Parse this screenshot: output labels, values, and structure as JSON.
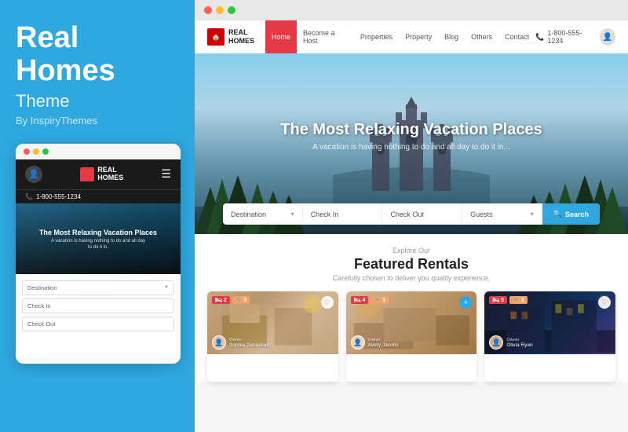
{
  "left": {
    "title_line1": "Real",
    "title_line2": "Homes",
    "subtitle": "Theme",
    "author": "By InspiryThemes",
    "brand_label": "REAL HOMES"
  },
  "mobile": {
    "dots": [
      "red",
      "yellow",
      "green"
    ],
    "nav": {
      "logo_text": "REAL\nHOMES",
      "phone": "1-800-555-1234"
    },
    "hero": {
      "title": "The Most Relaxing Vacation Places",
      "subtitle": "A vacation is having nothing to do and all day\nto do it in."
    },
    "search_fields": [
      "Destination",
      "Check In",
      "Check Out"
    ]
  },
  "desktop": {
    "dots": [
      "red",
      "yellow",
      "green"
    ],
    "nav": {
      "logo_text": "REAL\nHOMES",
      "items": [
        "Home",
        "Become a Host",
        "Properties",
        "Property",
        "Blog",
        "Others",
        "Contact"
      ],
      "active_item": "Home",
      "phone": "1-800-555-1234"
    },
    "hero": {
      "title": "The Most Relaxing Vacation Places",
      "subtitle": "A vacation is having nothing to do and all day to do it in..."
    },
    "search": {
      "fields": [
        "Destination",
        "Check In",
        "Check Out",
        "Guests"
      ],
      "button": "Search"
    },
    "featured": {
      "eyebrow": "Explore Our",
      "title": "Featured Rentals",
      "description": "Carefully chosen to deliver you quality experience.",
      "cards": [
        {
          "owner_label": "Owner",
          "owner_name": "Sophia Sebastian",
          "badges": [
            "2",
            "3"
          ]
        },
        {
          "owner_label": "Owner",
          "owner_name": "Avery Jacobs",
          "badges": [
            "4",
            "3"
          ]
        },
        {
          "owner_label": "Owner",
          "owner_name": "Olivia Ryan",
          "badges": [
            "5",
            "3"
          ]
        }
      ]
    }
  }
}
